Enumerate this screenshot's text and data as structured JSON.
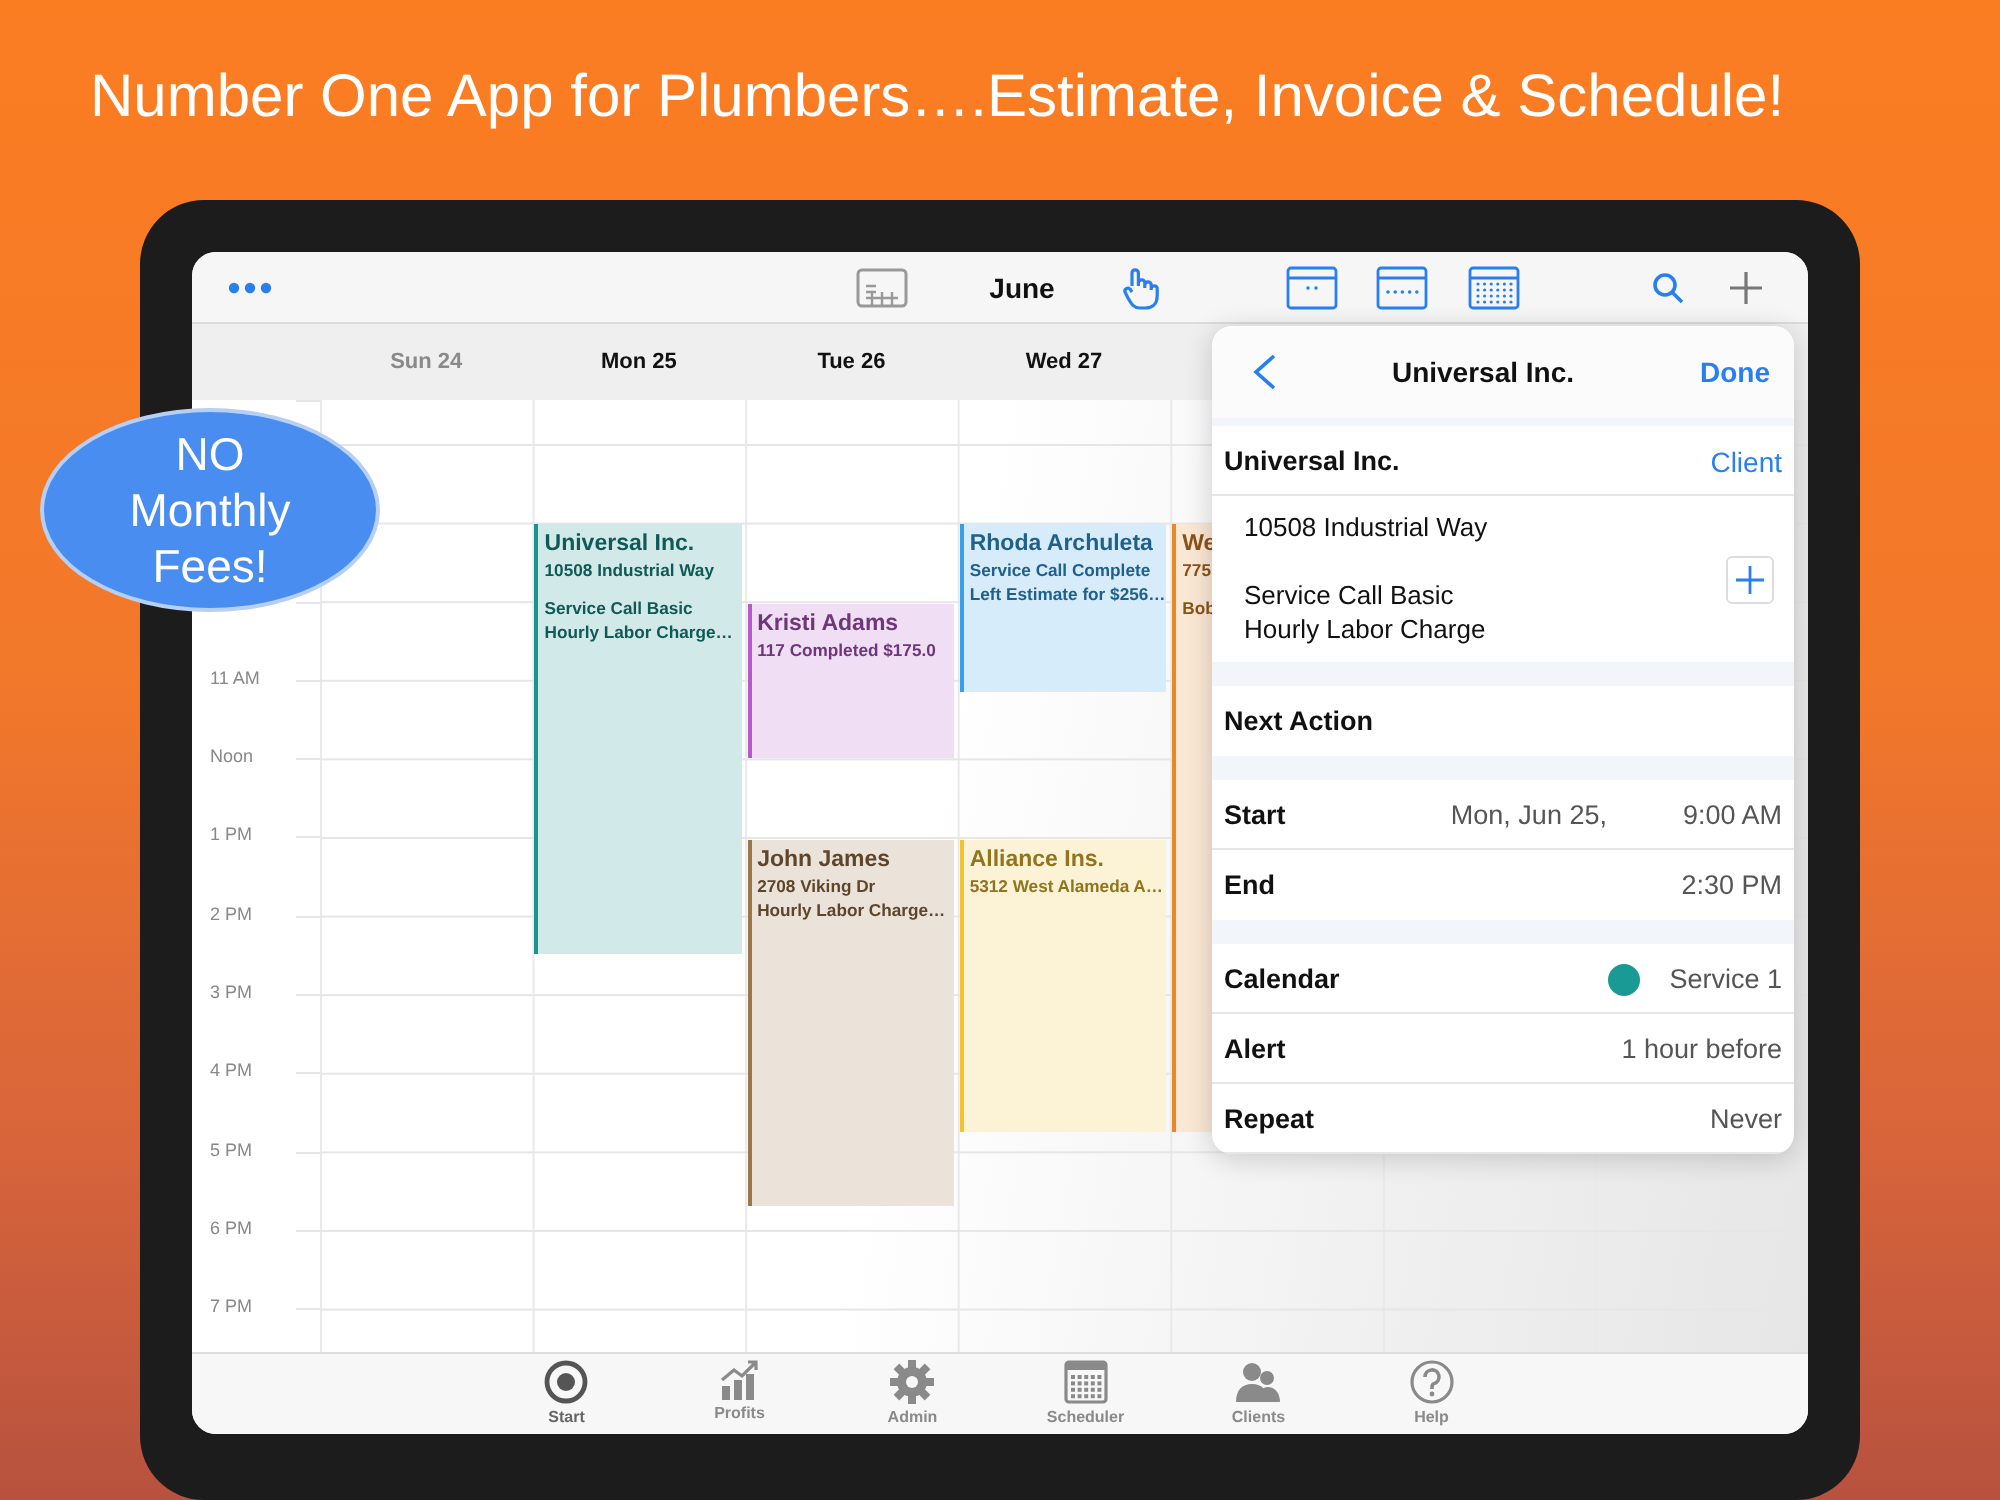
{
  "headline": "Number One App for Plumbers….Estimate, Invoice & Schedule!",
  "promo_bubble": {
    "lines": [
      "NO",
      "Monthly",
      "Fees!"
    ]
  },
  "toolbar": {
    "month": "June"
  },
  "days": [
    {
      "label": "Sun 24",
      "dimmed": true
    },
    {
      "label": "Mon 25",
      "dimmed": false
    },
    {
      "label": "Tue 26",
      "dimmed": false
    },
    {
      "label": "Wed 27",
      "dimmed": false
    }
  ],
  "time_labels": [
    "11 AM",
    "Noon",
    "1 PM",
    "2 PM",
    "3 PM",
    "4 PM",
    "5 PM",
    "6 PM",
    "7 PM"
  ],
  "events": [
    {
      "title": "Universal Inc.",
      "lines": [
        "10508 Industrial Way"
      ],
      "notes": [
        "Service Call Basic",
        "Hourly Labor Charge…"
      ],
      "color": "#1a9490"
    },
    {
      "title": "Kristi Adams",
      "lines": [
        "117 Completed $175.0"
      ],
      "color": "#b55bc9"
    },
    {
      "title": "John James",
      "lines": [
        "2708 Viking Dr",
        "Hourly Labor Charge…"
      ],
      "color": "#9c7548"
    },
    {
      "title": "Rhoda Archuleta",
      "lines": [
        "Service Call Complete",
        "Left Estimate for $256…"
      ],
      "color": "#36a0ea"
    },
    {
      "title": "Alliance Ins.",
      "lines": [
        "5312 West Alameda A…"
      ],
      "color": "#f2c230"
    },
    {
      "title": "We",
      "lines": [
        "775"
      ],
      "notes": [
        "Bob"
      ],
      "color": "#e8882a"
    }
  ],
  "detail": {
    "title": "Universal Inc.",
    "done": "Done",
    "client_name": "Universal Inc.",
    "client_link": "Client",
    "address": "10508 Industrial Way",
    "items": [
      "Service Call Basic",
      "Hourly Labor Charge"
    ],
    "next_action": "Next Action",
    "times": [
      {
        "label": "Start",
        "date": "Mon, Jun 25,",
        "time": "9:00 AM"
      },
      {
        "label": "End",
        "time": "2:30 PM"
      }
    ],
    "settings": [
      {
        "label": "Calendar",
        "value": "Service 1",
        "color": "#1a9a94"
      },
      {
        "label": "Alert",
        "value": "1 hour before"
      },
      {
        "label": "Repeat",
        "value": "Never"
      }
    ]
  },
  "tab_bar": [
    {
      "label": "Start",
      "selected": true
    },
    {
      "label": "Profits",
      "selected": false
    },
    {
      "label": "Admin",
      "selected": false
    },
    {
      "label": "Scheduler",
      "selected": false
    },
    {
      "label": "Clients",
      "selected": false
    },
    {
      "label": "Help",
      "selected": false
    }
  ]
}
